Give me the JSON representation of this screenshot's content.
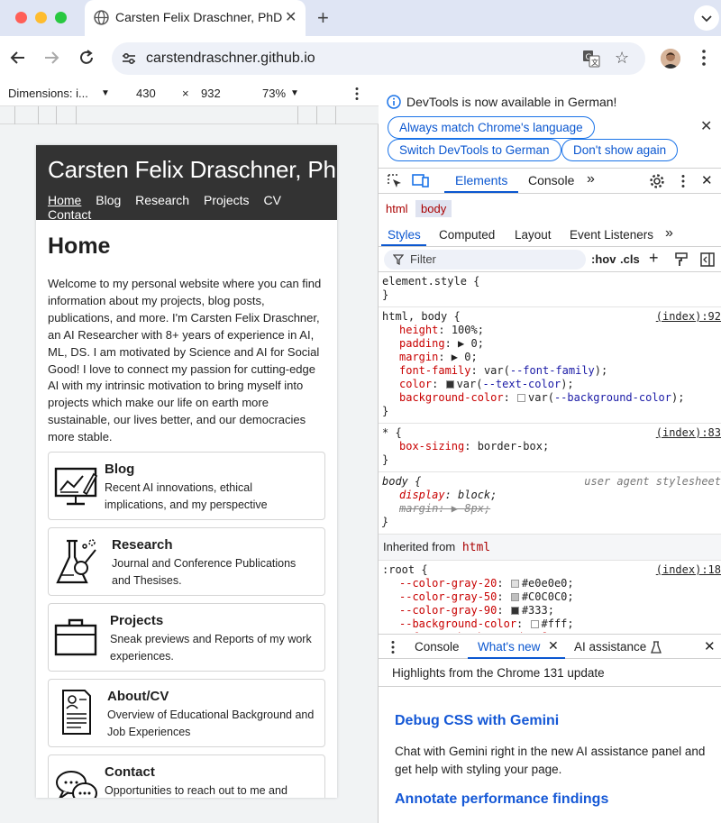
{
  "browser": {
    "tab_title": "Carsten Felix Draschner, PhD",
    "url": "carstendraschner.github.io"
  },
  "device_toolbar": {
    "dimensions_label": "Dimensions: i...",
    "width": "430",
    "times": "×",
    "height": "932",
    "zoom": "73%"
  },
  "site": {
    "title": "Carsten Felix Draschner, PhD",
    "nav": [
      "Home",
      "Blog",
      "Research",
      "Projects",
      "CV",
      "Contact"
    ],
    "heading": "Home",
    "intro": "Welcome to my personal website where you can find information about my projects, blog posts, publications, and more. I'm Carsten Felix Draschner, an AI Researcher with 8+ years of experience in AI, ML, DS. I am motivated by Science and AI for Social Good! I love to connect my passion for cutting-edge AI with my intrinsic motivation to bring myself into projects which make our life on earth more sustainable, our lives better, and our democracies more stable.",
    "cards": [
      {
        "title": "Blog",
        "text": "Recent AI innovations, ethical implications, and my perspective",
        "icon": "monitor-chart-icon"
      },
      {
        "title": "Research",
        "text": "Journal and Conference Publications and Thesises.",
        "icon": "lab-flask-icon"
      },
      {
        "title": "Projects",
        "text": "Sneak previews and Reports of my work experiences.",
        "icon": "briefcase-icon"
      },
      {
        "title": "About/CV",
        "text": "Overview of Educational Background and Job Experiences",
        "icon": "resume-icon"
      },
      {
        "title": "Contact",
        "text": "Opportunities to reach out to me and sources for more content",
        "icon": "chat-bubbles-icon"
      }
    ]
  },
  "devtools": {
    "infobar_message": "DevTools is now available in German!",
    "btn_match": "Always match Chrome's language",
    "btn_switch": "Switch DevTools to German",
    "btn_dont_show": "Don't show again",
    "tabs": {
      "elements": "Elements",
      "console": "Console"
    },
    "breadcrumbs": [
      "html",
      "body"
    ],
    "subtabs": [
      "Styles",
      "Computed",
      "Layout",
      "Event Listeners"
    ],
    "filter_placeholder": "Filter",
    "hov": ":hov",
    "cls": ".cls",
    "rules": {
      "element_style": "element.style {",
      "html_body_selector": "html, body {",
      "html_body_src": "(index):92",
      "star_selector": "* {",
      "star_src": "(index):83",
      "body_selector": "body {",
      "ua_label": "user agent stylesheet",
      "inherited_label": "Inherited from",
      "inherited_tag": "html",
      "root_selector": ":root {",
      "root_src": "(index):18",
      "close": "}"
    },
    "drawer": {
      "console": "Console",
      "whats_new": "What's new",
      "ai": "AI assistance",
      "highlights": "Highlights from the Chrome 131 update",
      "h1": "Debug CSS with Gemini",
      "p1": "Chat with Gemini right in the new AI assistance panel and get help with styling your page.",
      "h2": "Annotate performance findings"
    }
  }
}
